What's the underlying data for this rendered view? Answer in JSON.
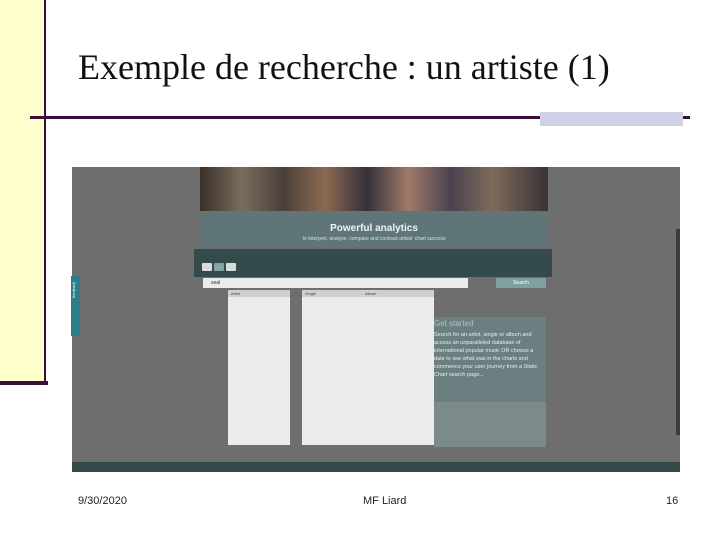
{
  "slide": {
    "title": "Exemple de recherche : un artiste (1)",
    "footer_date": "9/30/2020",
    "footer_author": "MF Liard",
    "footer_page": "16"
  },
  "screenshot": {
    "side_tab": "feedback",
    "hero_title": "Powerful analytics",
    "hero_sub": "to interpret, analyse, compare and contrast artists' chart success",
    "tabs": [
      "…",
      "…",
      "…"
    ],
    "search_value": "seal",
    "search_button": "Search",
    "dropdown": {
      "col1_head": "Artist",
      "col2_head": "Single",
      "col3_head": "Album"
    },
    "get_started_title": "Get started",
    "get_started_text": "Search for an artist, single or album and access an unparalleled database of international popular music OR choose a date to see what was in the charts and commence your user journey from a Static Chart search page..."
  }
}
